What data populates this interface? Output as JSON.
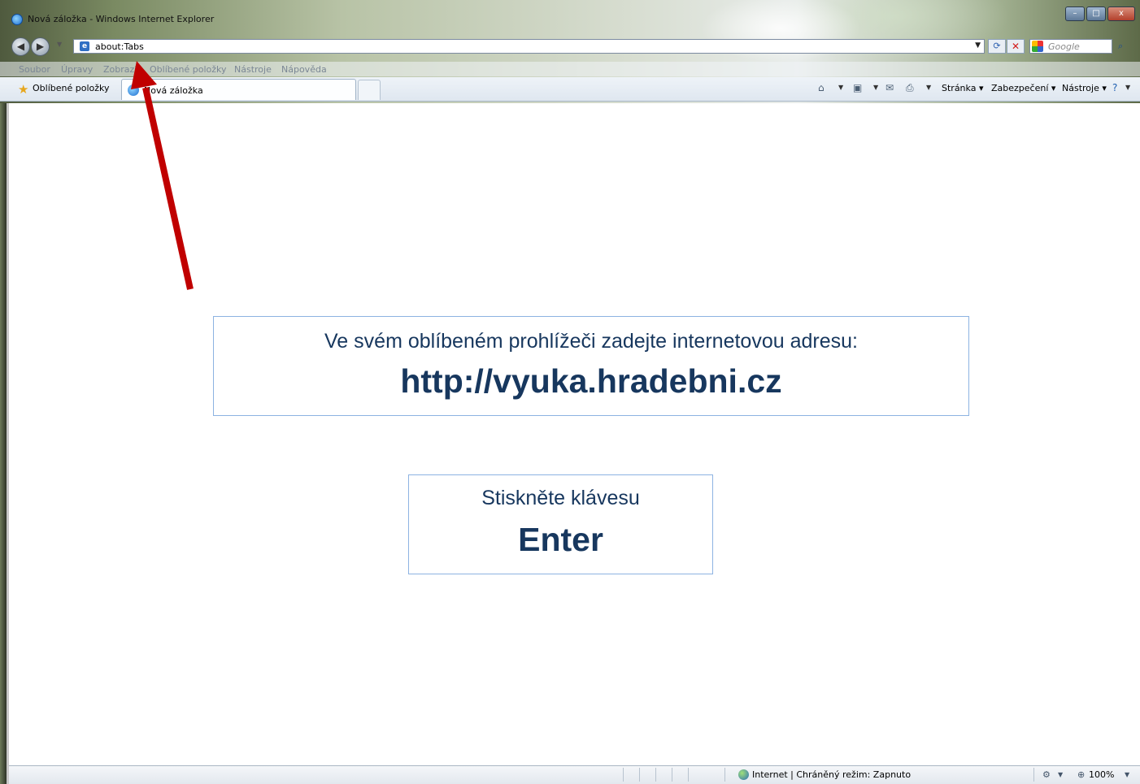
{
  "window": {
    "title": "Nová záložka - Windows Internet Explorer",
    "controls": {
      "minimize": "–",
      "maximize": "□",
      "close": "x"
    }
  },
  "address_bar": {
    "url": "about:Tabs",
    "search_placeholder": "Google"
  },
  "menu": {
    "items": [
      "Soubor",
      "Úpravy",
      "Zobrazit",
      "Oblíbené položky",
      "Nástroje",
      "Nápověda"
    ]
  },
  "favorites_bar": {
    "label": "Oblíbené položky"
  },
  "tab": {
    "label": "Nová záložka"
  },
  "command_bar": {
    "page_label": "Stránka ▾",
    "security_label": "Zabezpečení ▾",
    "tools_label": "Nástroje ▾"
  },
  "content": {
    "instruction_line": "Ve svém oblíbeném prohlížeči zadejte internetovou adresu:",
    "address": "http://vyuka.hradebni.cz",
    "press_line": "Stiskněte klávesu",
    "key": "Enter"
  },
  "annotation": {
    "arrow_color": "#c00000"
  },
  "status_bar": {
    "zone_text": "Internet | Chráněný režim: Zapnuto",
    "zoom": "100%"
  }
}
